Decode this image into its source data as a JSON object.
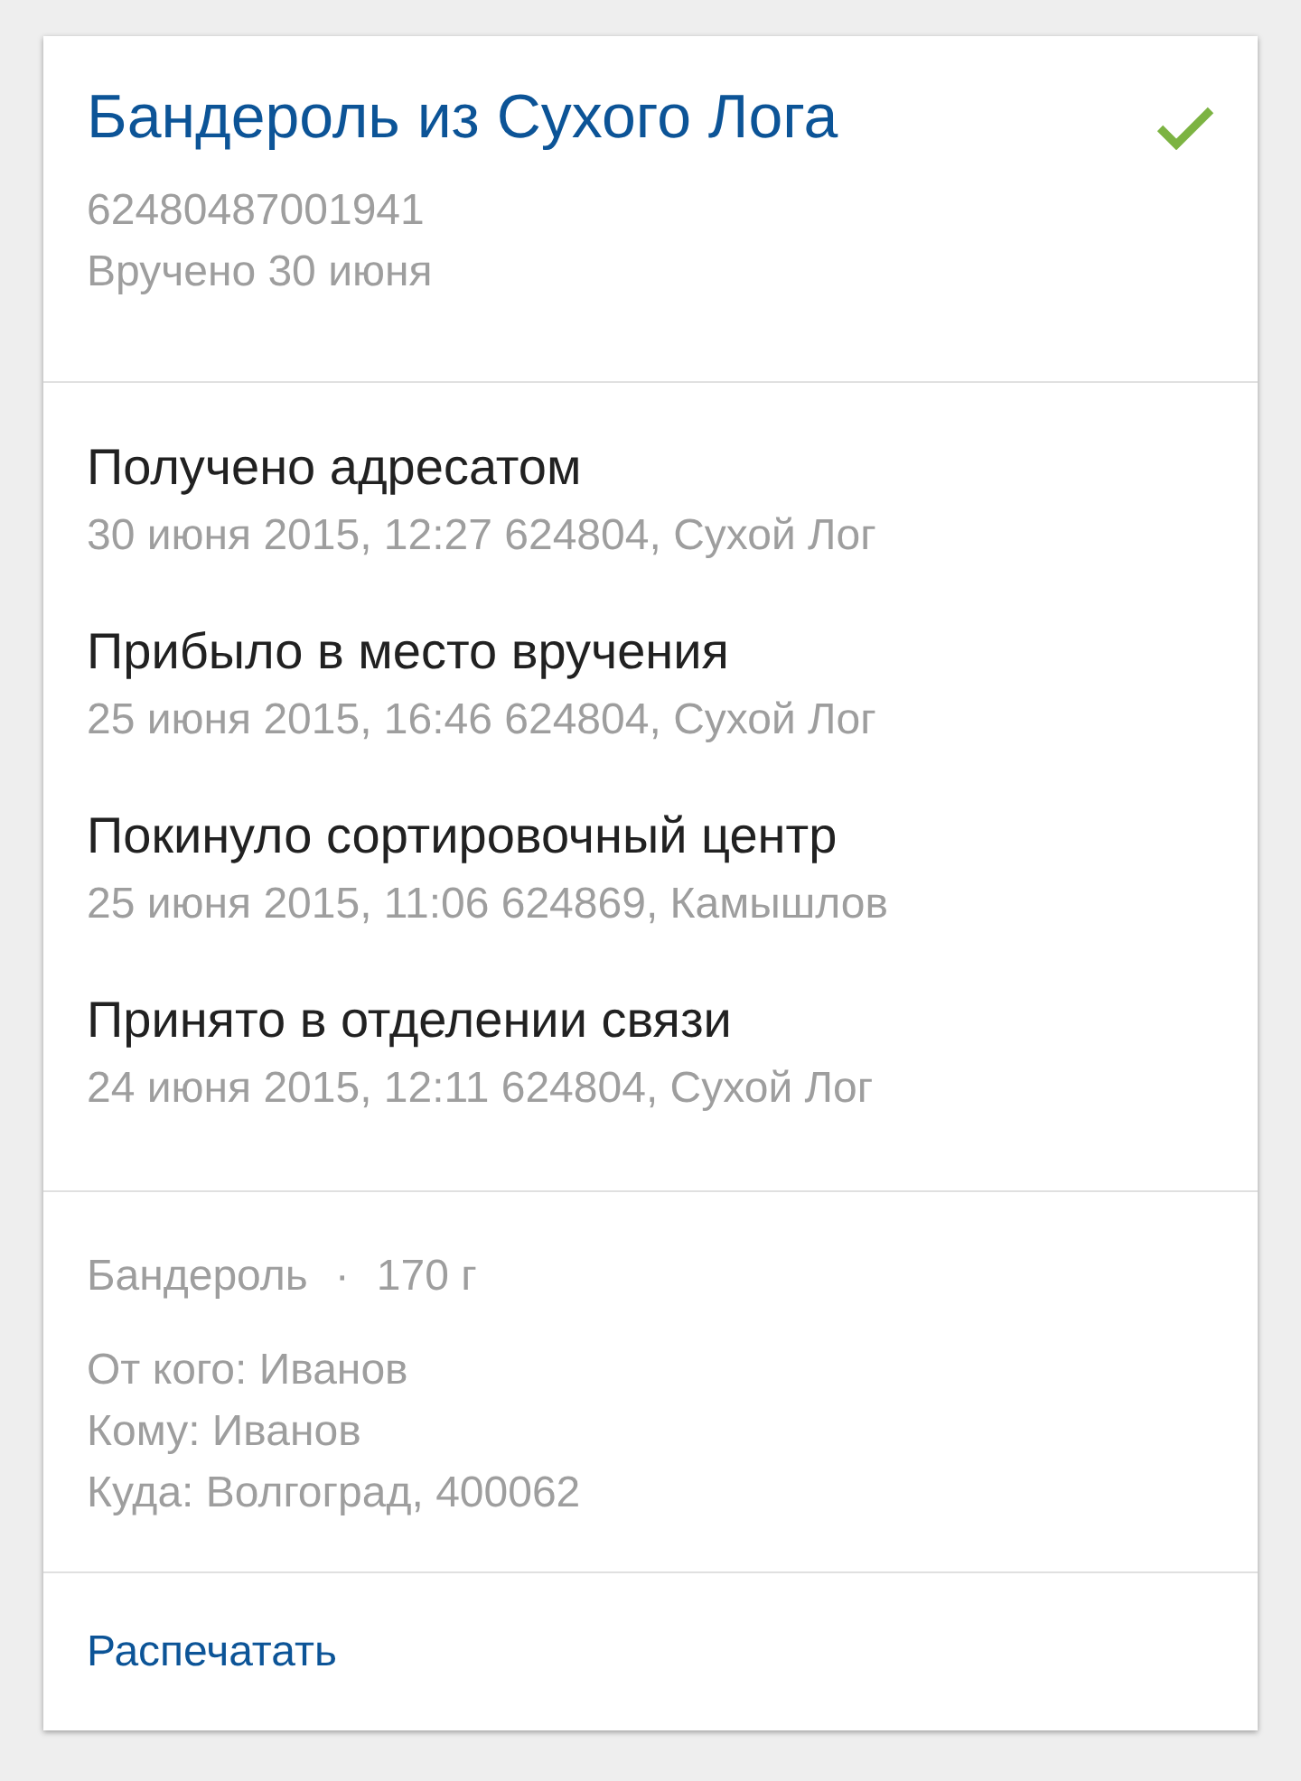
{
  "parcel": {
    "title": "Бандероль из Сухого Лога",
    "delivered": true,
    "tracking_number": "62480487001941",
    "status": "Вручено 30 июня"
  },
  "events": [
    {
      "title": "Получено адресатом",
      "details": "30 июня 2015, 12:27 624804, Сухой Лог"
    },
    {
      "title": "Прибыло в место вручения",
      "details": "25 июня 2015, 16:46 624804, Сухой Лог"
    },
    {
      "title": "Покинуло сортировочный центр",
      "details": "25 июня 2015, 11:06 624869, Камышлов"
    },
    {
      "title": "Принято в отделении связи",
      "details": "24 июня 2015, 12:11 624804, Сухой Лог"
    }
  ],
  "details": {
    "type": "Бандероль",
    "separator": "·",
    "weight": "170 г",
    "lines": [
      "От кого: Иванов",
      "Кому: Иванов",
      "Куда: Волгоград, 400062"
    ]
  },
  "actions": [
    {
      "label": "Распечатать"
    }
  ]
}
